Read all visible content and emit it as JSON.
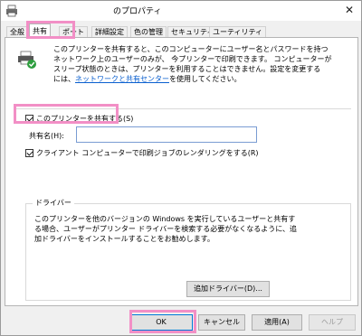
{
  "window": {
    "title": "のプロパティ"
  },
  "tabs": [
    {
      "label": "全般"
    },
    {
      "label": "共有"
    },
    {
      "label": "ポート"
    },
    {
      "label": "詳細設定"
    },
    {
      "label": "色の管理"
    },
    {
      "label": "セキュリティ"
    },
    {
      "label": "ユーティリティ"
    }
  ],
  "sharing": {
    "desc_line1": "このプリンターを共有すると、このコンピューターにユーザー名とパスワードを持つ",
    "desc_line2": "ネットワーク上のユーザーのみが、 今プリンターで印刷できます。 コンピューターが",
    "desc_line3": "スリープ状態のときは、プリンターを利用することはできません。設定を変更する",
    "desc_line4_prefix": "には、",
    "desc_link": "ネットワークと共有センター",
    "desc_line4_suffix": "を使用してください。",
    "share_checkbox_label": "このプリンターを共有する(S)",
    "share_checked": true,
    "share_name_label": "共有名(H):",
    "share_name_value": "",
    "render_checkbox_label": "クライアント コンピューターで印刷ジョブのレンダリングをする(R)",
    "render_checked": true
  },
  "drivers": {
    "title": "ドライバー",
    "text_line1": "このプリンターを他のバージョンの Windows を実行しているユーザーと共有す",
    "text_line2": "る場合、ユーザーがプリンター ドライバーを検索する必要がなくなるように、追",
    "text_line3": "加ドライバーをインストールすることをお勧めします。",
    "additional_button": "追加ドライバー(D)..."
  },
  "footer": {
    "ok": "OK",
    "cancel": "キャンセル",
    "apply": "適用(A)",
    "help": "ヘルプ"
  },
  "colors": {
    "highlight": "#f28fc6",
    "link": "#0a5fcf",
    "focus_border": "#0078d7"
  }
}
